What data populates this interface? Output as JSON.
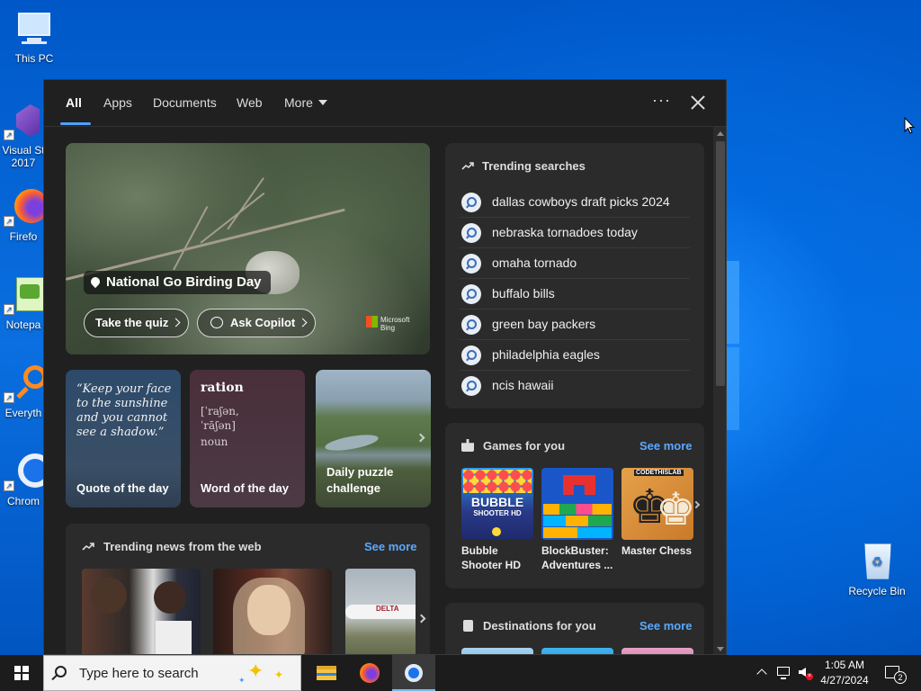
{
  "desktop": {
    "icons": [
      {
        "label": "This PC"
      },
      {
        "label": "Visual St 2017"
      },
      {
        "label": "Firefo"
      },
      {
        "label": "Notepa"
      },
      {
        "label": "Everyth"
      },
      {
        "label": "Chrom"
      },
      {
        "label": "Recycle Bin"
      }
    ]
  },
  "search_panel": {
    "tabs": [
      {
        "label": "All",
        "active": true
      },
      {
        "label": "Apps"
      },
      {
        "label": "Documents"
      },
      {
        "label": "Web"
      },
      {
        "label": "More"
      }
    ],
    "more_icon": "ellipsis-icon",
    "close_icon": "close-icon",
    "hero": {
      "title": "National Go Birding Day",
      "buttons": [
        {
          "label": "Take the quiz"
        },
        {
          "label": "Ask Copilot"
        }
      ],
      "brand": [
        "Microsoft",
        "Bing"
      ]
    },
    "cards": [
      {
        "caption": "Quote of the day",
        "text": "“Keep your face to the sunshine and you cannot see a shadow.”"
      },
      {
        "caption": "Word of the day",
        "word": "ration",
        "pronunciation": "[ˈraʃən,\nˈrāʃən]",
        "part_of_speech": "noun"
      },
      {
        "caption": "Daily puzzle challenge"
      }
    ],
    "trending_news": {
      "title": "Trending news from the web",
      "see_more": "See more",
      "badge": "DELTA"
    },
    "trending_searches": {
      "title": "Trending searches",
      "items": [
        "dallas cowboys draft picks 2024",
        "nebraska tornadoes today",
        "omaha tornado",
        "buffalo bills",
        "green bay packers",
        "philadelphia eagles",
        "ncis hawaii"
      ]
    },
    "games": {
      "title": "Games for you",
      "see_more": "See more",
      "items": [
        {
          "name": "Bubble Shooter HD",
          "art_text": "BUBBLE",
          "art_sub": "SHOOTER HD"
        },
        {
          "name": "BlockBuster: Adventures ..."
        },
        {
          "name": "Master Chess",
          "art_text": "CODETHISLAB"
        }
      ]
    },
    "destinations": {
      "title": "Destinations for you",
      "see_more": "See more"
    }
  },
  "taskbar": {
    "search_placeholder": "Type here to search",
    "clock": {
      "time": "1:05 AM",
      "date": "4/27/2024"
    },
    "notification_count": "2",
    "apps": [
      "file-explorer-icon",
      "firefox-icon",
      "chrome-icon"
    ]
  },
  "colors": {
    "accent": "#4ea1ff",
    "link": "#5aa9ff",
    "panel": "#202020",
    "card": "#2b2b2b",
    "desktop": "#0a6fe0"
  }
}
